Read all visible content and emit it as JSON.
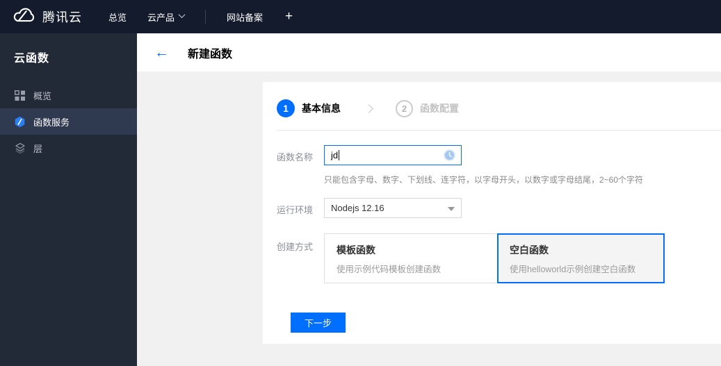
{
  "navbar": {
    "brand": "腾讯云",
    "items": [
      {
        "label": "总览"
      },
      {
        "label": "云产品"
      },
      {
        "label": "网站备案"
      }
    ],
    "plus_label": "+"
  },
  "sidebar": {
    "title": "云函数",
    "items": [
      {
        "label": "概览",
        "icon": "grid-icon",
        "selected": false
      },
      {
        "label": "函数服务",
        "icon": "function-service-icon",
        "selected": true
      },
      {
        "label": "层",
        "icon": "layers-icon",
        "selected": false
      }
    ]
  },
  "header": {
    "back_icon": "←",
    "title": "新建函数"
  },
  "wizard": {
    "steps": [
      {
        "number": "1",
        "label": "基本信息",
        "active": true
      },
      {
        "number": "2",
        "label": "函数配置",
        "active": false
      }
    ]
  },
  "form": {
    "name_label": "函数名称",
    "name_value": "jd",
    "name_help": "只能包含字母、数字、下划线、连字符，以字母开头，以数字或字母结尾，2~60个字符",
    "runtime_label": "运行环境",
    "runtime_value": "Nodejs 12.16",
    "method_label": "创建方式",
    "methods": [
      {
        "title": "模板函数",
        "desc": "使用示例代码模板创建函数",
        "selected": false
      },
      {
        "title": "空白函数",
        "desc": "使用helloworld示例创建空白函数",
        "selected": true
      }
    ],
    "next_button": "下一步"
  },
  "colors": {
    "accent": "#006eff",
    "navbar_bg": "#131b2c",
    "sidebar_bg": "#232a37",
    "sidebar_selected_bg": "#2f3950",
    "content_bg": "#f1f1f1"
  }
}
